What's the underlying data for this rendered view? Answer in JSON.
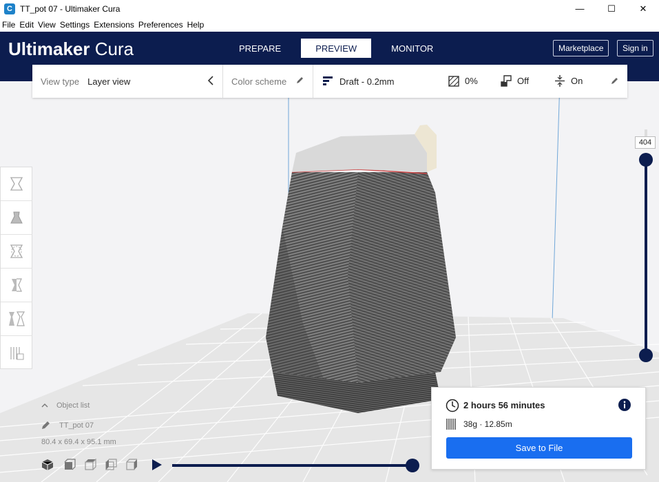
{
  "window": {
    "app_icon_letter": "C",
    "title": "TT_pot 07 - Ultimaker Cura",
    "minimize": "—",
    "maximize": "☐",
    "close": "✕"
  },
  "menu": [
    "File",
    "Edit",
    "View",
    "Settings",
    "Extensions",
    "Preferences",
    "Help"
  ],
  "header": {
    "logo_bold": "Ultimaker",
    "logo_light": "Cura",
    "tabs": [
      {
        "label": "PREPARE",
        "active": false
      },
      {
        "label": "PREVIEW",
        "active": true
      },
      {
        "label": "MONITOR",
        "active": false
      }
    ],
    "marketplace_label": "Marketplace",
    "signin_label": "Sign in"
  },
  "settings_bar": {
    "view_type_label": "View type",
    "view_type_value": "Layer view",
    "color_scheme_label": "Color scheme",
    "profile": "Draft - 0.2mm",
    "infill": "0%",
    "support": "Off",
    "adhesion": "On"
  },
  "left_tools": [
    "move-tool-icon",
    "scale-tool-icon",
    "rotate-tool-icon",
    "mirror-tool-icon",
    "per-model-settings-icon",
    "support-blocker-icon"
  ],
  "layer_slider": {
    "current_layer": "404"
  },
  "object_info": {
    "object_list_label": "Object list",
    "object_name": "TT_pot 07",
    "dimensions": "80.4 x 69.4 x 95.1 mm"
  },
  "print_info": {
    "time": "2 hours 56 minutes",
    "material": "38g · 12.85m",
    "save_label": "Save to File"
  },
  "colors": {
    "header_bg": "#0c1d4f",
    "accent": "#196ef0",
    "slider": "#0c1d4f"
  }
}
